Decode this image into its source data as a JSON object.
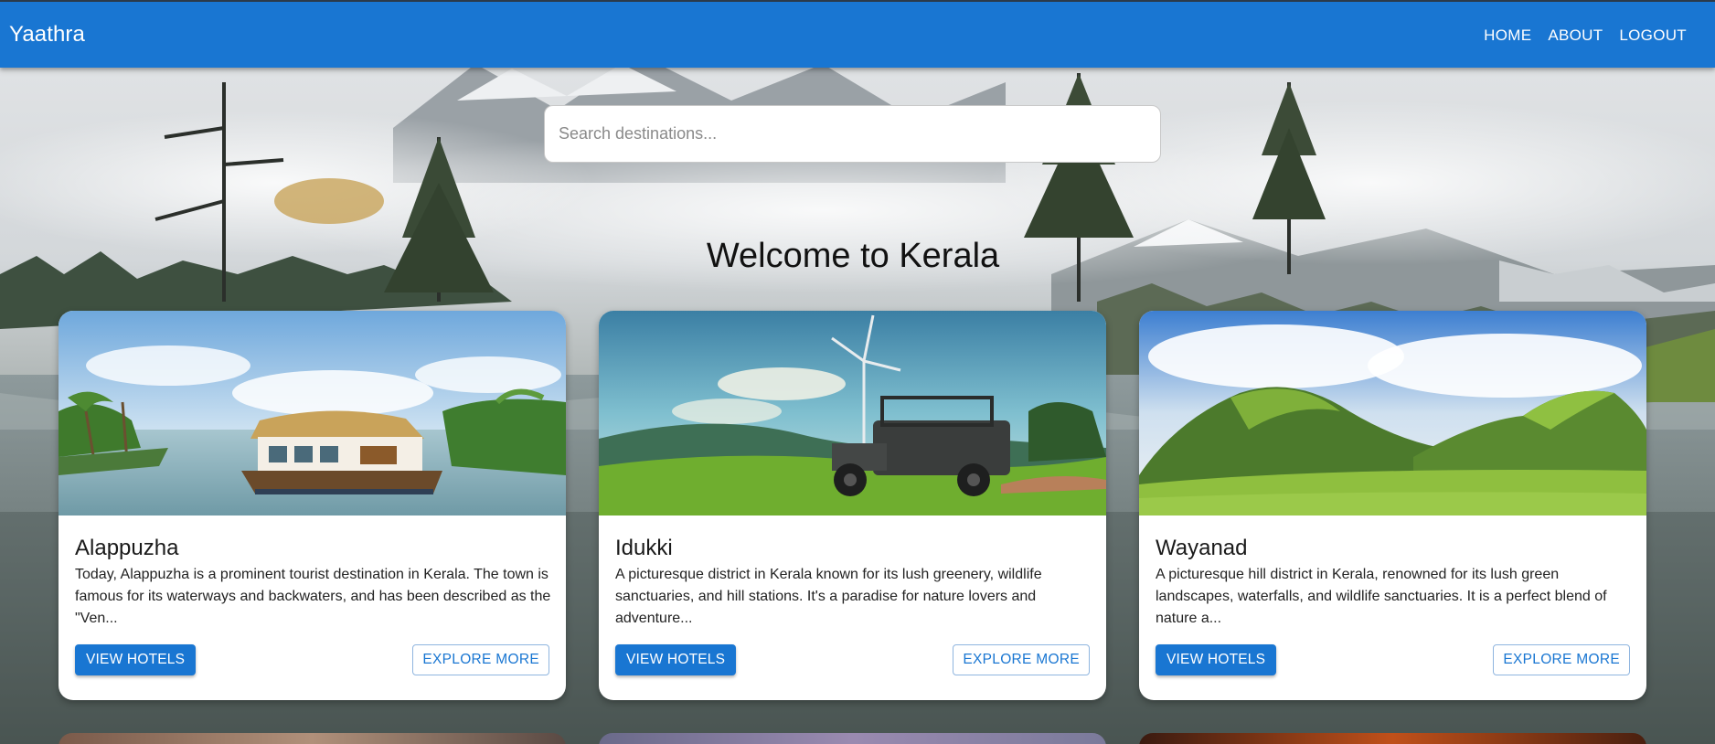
{
  "app": {
    "brand": "Yaathra"
  },
  "nav": [
    {
      "label": "HOME"
    },
    {
      "label": "ABOUT"
    },
    {
      "label": "LOGOUT"
    }
  ],
  "search": {
    "placeholder": "Search destinations...",
    "value": ""
  },
  "page": {
    "heading": "Welcome to Kerala"
  },
  "destinations": [
    {
      "name": "Alappuzha",
      "description": "Today, Alappuzha is a prominent tourist destination in Kerala. The town is famous for its waterways and backwaters, and has been described as the \"Ven...",
      "primary_label": "VIEW HOTELS",
      "secondary_label": "EXPLORE MORE"
    },
    {
      "name": "Idukki",
      "description": "A picturesque district in Kerala known for its lush greenery, wildlife sanctuaries, and hill stations. It's a paradise for nature lovers and adventure...",
      "primary_label": "VIEW HOTELS",
      "secondary_label": "EXPLORE MORE"
    },
    {
      "name": "Wayanad",
      "description": "A picturesque hill district in Kerala, renowned for its lush green landscapes, waterfalls, and wildlife sanctuaries. It is a perfect blend of nature a...",
      "primary_label": "VIEW HOTELS",
      "secondary_label": "EXPLORE MORE"
    }
  ],
  "colors": {
    "primary": "#1976d2",
    "card_bg": "#ffffff",
    "heading": "#111111"
  },
  "icons": {
    "background": "mountain-lake-landscape-image",
    "card_photos": [
      "houseboat-backwaters-image",
      "jeep-windmill-hills-image",
      "green-hills-image"
    ]
  }
}
